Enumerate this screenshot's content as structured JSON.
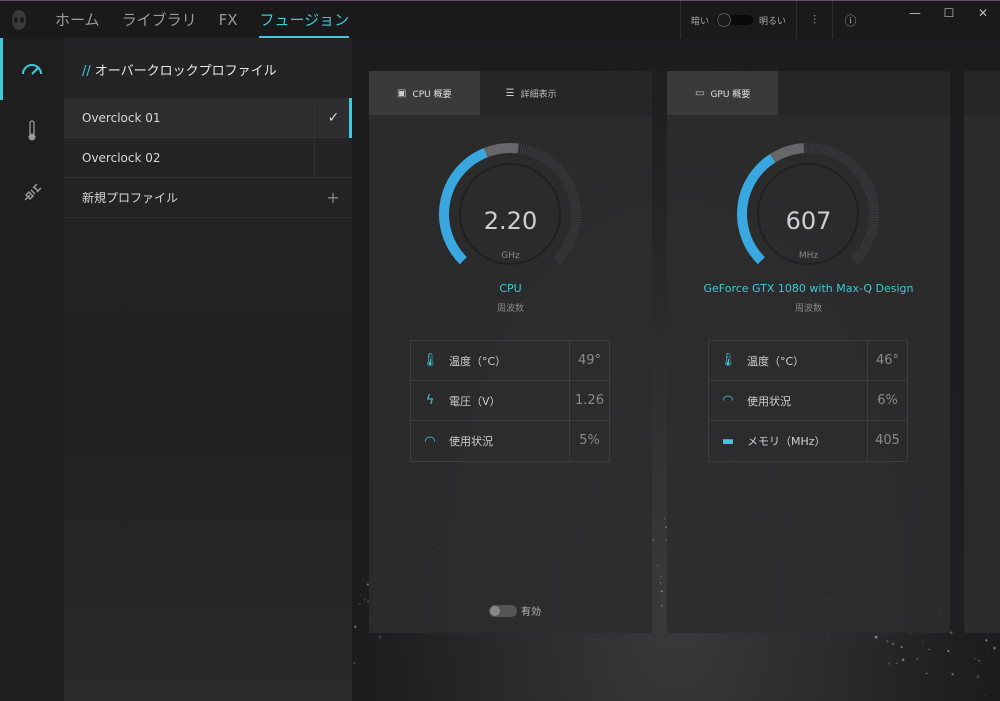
{
  "nav": {
    "tabs": [
      "ホーム",
      "ライブラリ",
      "FX",
      "フュージョン"
    ],
    "active_index": 3
  },
  "brightness": {
    "dark_label": "暗い",
    "bright_label": "明るい"
  },
  "window": {
    "minimize": "—",
    "maximize": "☐",
    "close": "✕"
  },
  "rail": {
    "items": [
      "overclock-gauge-icon",
      "thermometer-icon",
      "power-plug-icon"
    ],
    "active_index": 0
  },
  "profiles": {
    "title_prefix": "//",
    "title": "オーバークロックプロファイル",
    "items": [
      {
        "label": "Overclock 01",
        "selected": true,
        "action": "✓"
      },
      {
        "label": "Overclock 02",
        "selected": false,
        "action": ""
      },
      {
        "label": "新規プロファイル",
        "selected": false,
        "action": "+"
      }
    ]
  },
  "cpu_card": {
    "tabs": [
      "CPU 概要",
      "詳細表示"
    ],
    "gauge_value": "2.20",
    "gauge_unit": "GHz",
    "gauge_fill": 0.42,
    "device_name": "CPU",
    "device_sub": "周波数",
    "stats": [
      {
        "icon": "thermometer-icon",
        "label": "温度（°C）",
        "value": "49°"
      },
      {
        "icon": "voltage-bolt-icon",
        "label": "電圧（V）",
        "value": "1.26"
      },
      {
        "icon": "usage-gauge-icon",
        "label": "使用状況",
        "value": "5%"
      }
    ],
    "toggle_label": "有効"
  },
  "gpu_card": {
    "tabs": [
      "GPU 概要"
    ],
    "gauge_value": "607",
    "gauge_unit": "MHz",
    "gauge_fill": 0.38,
    "device_name": "GeForce GTX 1080 with Max-Q Design",
    "device_sub": "周波数",
    "stats": [
      {
        "icon": "thermometer-icon",
        "label": "温度（°C）",
        "value": "46°"
      },
      {
        "icon": "usage-gauge-icon",
        "label": "使用状況",
        "value": "6%"
      },
      {
        "icon": "memory-chip-icon",
        "label": "メモリ（MHz）",
        "value": "405"
      }
    ]
  },
  "colors": {
    "accent": "#3ec8d8",
    "gauge_blue": "#3aa8e0"
  }
}
